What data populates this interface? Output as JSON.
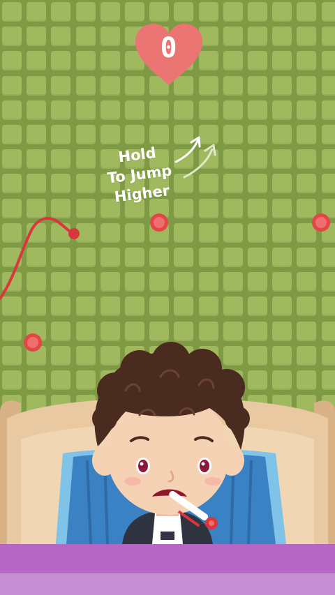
{
  "game": {
    "score": "0",
    "hint_lines": [
      "Hold",
      "To Jump",
      "Higher"
    ]
  },
  "colors": {
    "wall": "#8fa84f",
    "tile": "#a0b95f",
    "heart": "#ea7573",
    "dot": "#e24646",
    "rope": "#d9363e",
    "floor_top": "#b666c4",
    "floor_bottom": "#c78fd3",
    "sofa": "#e9c9a1",
    "pillow": "#3b82c4",
    "hair": "#4a2b1f",
    "skin": "#f6d2b4"
  },
  "icons": [
    "heart-icon",
    "arrow-icon",
    "thermometer-icon"
  ]
}
